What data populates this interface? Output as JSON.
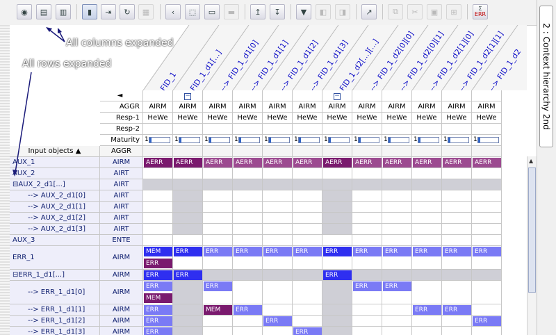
{
  "toolbar": {
    "buttons": [
      "expand-rows-icon",
      "collapse-icon",
      "columns-icon",
      "select-mode-icon",
      "move-icon",
      "refresh-icon",
      "grid-icon",
      "left-icon",
      "cut-cells-icon",
      "edit-icon",
      "comment-icon",
      "sort-up-icon",
      "sort-down-icon",
      "filter-icon",
      "mark-icon",
      "unmark-icon",
      "export-icon",
      "copy-icon",
      "scissors-icon",
      "paste-icon",
      "merge-icon",
      "sigma-err-icon"
    ],
    "sum_label": "Σ",
    "err_label": "ERR"
  },
  "side_tab": "2 : Context hierarchy 2nd",
  "annotations": {
    "columns": "All columns expanded",
    "rows": "All rows expanded"
  },
  "columns": [
    {
      "label": "FID_1",
      "aggr": "AIRM",
      "resp": "HeWe"
    },
    {
      "label": "FID_1_d1[...]",
      "aggr": "AIRM",
      "resp": "HeWe"
    },
    {
      "label": "--> FID_1_d1[0]",
      "aggr": "AIRM",
      "resp": "HeWe"
    },
    {
      "label": "--> FID_1_d1[1]",
      "aggr": "AIRM",
      "resp": "HeWe"
    },
    {
      "label": "--> FID_1_d1[2]",
      "aggr": "AIRM",
      "resp": "HeWe"
    },
    {
      "label": "--> FID_1_d1[3]",
      "aggr": "AIRM",
      "resp": "HeWe"
    },
    {
      "label": "FID_1_d2[...][...]",
      "aggr": "AIRM",
      "resp": "HeWe"
    },
    {
      "label": "--> FID_1_d2[0][0]",
      "aggr": "AIRM",
      "resp": "HeWe"
    },
    {
      "label": "--> FID_1_d2[0][1]",
      "aggr": "AIRM",
      "resp": "HeWe"
    },
    {
      "label": "--> FID_1_d2[1][0]",
      "aggr": "AIRM",
      "resp": "HeWe"
    },
    {
      "label": "--> FID_1_d2[1][1]",
      "aggr": "AIRM",
      "resp": "HeWe"
    },
    {
      "label": "--> FID_1_d2",
      "aggr": "AIRM",
      "resp": "HeWe"
    }
  ],
  "header_rows": {
    "nav": "◄",
    "aggr": "AGGR",
    "resp1": "Resp-1",
    "resp2": "Resp-2",
    "maturity": "Maturity",
    "maturity_value": "1",
    "input_objects": "Input objects ▲",
    "aggr2": "AGGR",
    "collapse_glyph": "−"
  },
  "rows": [
    {
      "name": "AUX_1",
      "type": "AIRM"
    },
    {
      "name": "AUX_2",
      "type": "AIRT"
    },
    {
      "name": "⊟AUX_2_d1[...]",
      "type": "AIRT"
    },
    {
      "name": "--> AUX_2_d1[0]",
      "type": "AIRT"
    },
    {
      "name": "--> AUX_2_d1[1]",
      "type": "AIRT"
    },
    {
      "name": "--> AUX_2_d1[2]",
      "type": "AIRT"
    },
    {
      "name": "--> AUX_2_d1[3]",
      "type": "AIRT"
    },
    {
      "name": "AUX_3",
      "type": "ENTE"
    },
    {
      "name": "ERR_1",
      "type": "AIRM"
    },
    {
      "name": "⊟ERR_1_d1[...]",
      "type": "AIRM"
    },
    {
      "name": "--> ERR_1_d1[0]",
      "type": "AIRM"
    },
    {
      "name": "--> ERR_1_d1[1]",
      "type": "AIRM"
    },
    {
      "name": "--> ERR_1_d1[2]",
      "type": "AIRM"
    },
    {
      "name": "--> ERR_1_d1[3]",
      "type": "AIRM"
    }
  ],
  "chips": {
    "aerr": "AERR",
    "err": "ERR",
    "mem": "MEM"
  },
  "colors": {
    "accent_blue": "#2f2ff0",
    "pale_blue": "#7a7af5",
    "purple": "#7a1a6e",
    "header_text": "#1010c8"
  }
}
